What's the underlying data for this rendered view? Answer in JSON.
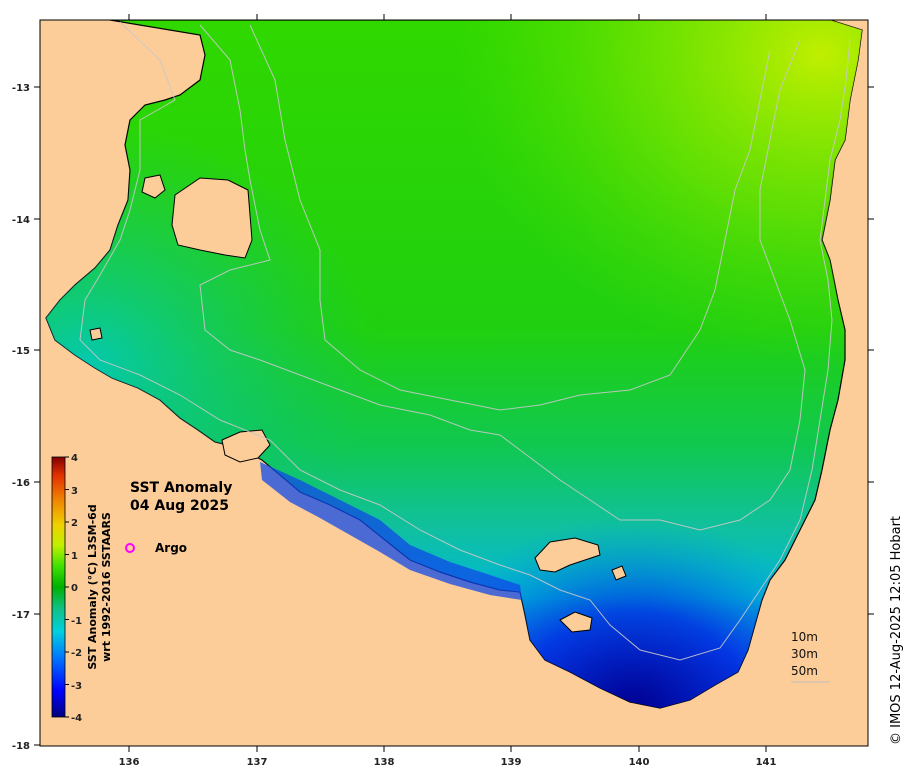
{
  "map": {
    "title_line1": "SST Anomaly",
    "title_line2": "04 Aug 2025",
    "legend_marker_label": "Argo",
    "legend_marker_color": "#ff00ff",
    "land_color": "#fccd99",
    "coastline_color": "#000000",
    "depth_contour_color": "#c0c0c0",
    "depth_contour_labels": [
      "10m",
      "30m",
      "50m"
    ],
    "credit": "© IMOS 12-Aug-2025 12:05 Hobart",
    "x_ticks": [
      "136",
      "137",
      "138",
      "139",
      "140",
      "141"
    ],
    "y_ticks": [
      "-13",
      "-14",
      "-15",
      "-16",
      "-17",
      "-18"
    ],
    "colorbar": {
      "label_line1": "SST Anomaly (°C) L3SM-6d",
      "label_line2": "wrt 1992-2016 SSTAARS",
      "ticks": [
        "4",
        "3",
        "2",
        "1",
        "0",
        "-1",
        "-2",
        "-3",
        "-4"
      ],
      "range": [
        -4,
        4
      ],
      "colors": [
        "#00007f",
        "#0000ff",
        "#0080ff",
        "#00d0d0",
        "#10c080",
        "#00b000",
        "#40e000",
        "#c0f000",
        "#f0d000",
        "#f08000",
        "#e03000",
        "#800000"
      ]
    },
    "ocean_palette": {
      "cool_south": "#0000a0",
      "cold": "#1040e0",
      "cool": "#00c0d0",
      "neutral": "#10c060",
      "green": "#20d020",
      "warm": "#a0f000"
    }
  }
}
